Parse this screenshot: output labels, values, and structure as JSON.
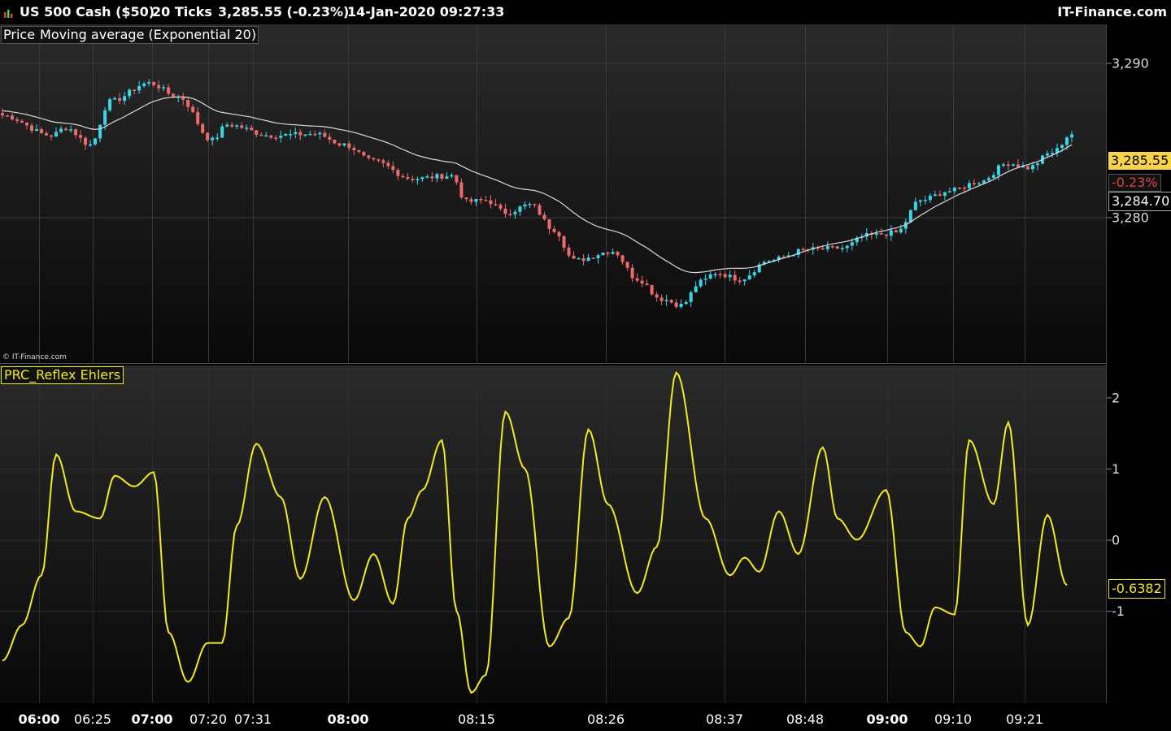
{
  "header": {
    "instrument": "US 500 Cash ($50)",
    "timeframe": "20 Ticks",
    "last_quote": "3,285.55 (-0.23%)",
    "datetime": "14-Jan-2020 09:27:33",
    "brand": "IT-Finance.com"
  },
  "price_panel": {
    "legend_price": "Price",
    "legend_ma": "Moving average (Exponential 20)",
    "copyright": "© IT-Finance.com",
    "last_price_label": "3,285.55",
    "change_label": "-0.23%",
    "ma_value_label": "3,284.70"
  },
  "indicator_panel": {
    "legend": "PRC_Reflex Ehlers",
    "last_value_label": "-0.6382"
  },
  "colors": {
    "background": "#000000",
    "up_bar": "#3ad6ec",
    "down_bar": "#f06a6a",
    "ma_line": "#d8d8d8",
    "indicator_line": "#f2ea1e",
    "price_tag_bg": "#f8d24a",
    "change_text": "#e04040"
  },
  "chart_data": [
    {
      "type": "candlestick",
      "title": "US 500 Cash ($50)",
      "ylim": [
        3270.6,
        3292.5
      ],
      "y_ticks": [
        3290,
        3280
      ],
      "y_tick_labels": [
        "3,290",
        "3,280"
      ],
      "x_tick_labels": [
        "06:00",
        "06:25",
        "07:00",
        "07:20",
        "07:31",
        "08:00",
        "08:15",
        "08:26",
        "08:37",
        "08:48",
        "09:00",
        "09:10",
        "09:21"
      ],
      "x_tick_bold": [
        true,
        false,
        true,
        false,
        false,
        true,
        false,
        false,
        false,
        false,
        true,
        false,
        false
      ],
      "bars": 220,
      "close_keypoints": [
        [
          0,
          3286.6
        ],
        [
          10,
          3285.3
        ],
        [
          13,
          3285.8
        ],
        [
          18,
          3284.7
        ],
        [
          22,
          3287.5
        ],
        [
          30,
          3288.7
        ],
        [
          36,
          3287.8
        ],
        [
          43,
          3285.0
        ],
        [
          46,
          3286.0
        ],
        [
          55,
          3285.3
        ],
        [
          64,
          3285.4
        ],
        [
          70,
          3284.7
        ],
        [
          76,
          3283.6
        ],
        [
          84,
          3282.5
        ],
        [
          92,
          3282.7
        ],
        [
          95,
          3281.0
        ],
        [
          99,
          3281.1
        ],
        [
          103,
          3280.3
        ],
        [
          108,
          3280.8
        ],
        [
          113,
          3279.2
        ],
        [
          117,
          3277.2
        ],
        [
          125,
          3277.8
        ],
        [
          130,
          3276.0
        ],
        [
          135,
          3274.7
        ],
        [
          139,
          3274.3
        ],
        [
          143,
          3275.8
        ],
        [
          146,
          3276.4
        ],
        [
          151,
          3276.0
        ],
        [
          157,
          3277.2
        ],
        [
          165,
          3277.9
        ],
        [
          172,
          3278.0
        ],
        [
          177,
          3278.8
        ],
        [
          183,
          3279.0
        ],
        [
          188,
          3281.1
        ],
        [
          194,
          3281.7
        ],
        [
          200,
          3282.3
        ],
        [
          206,
          3283.5
        ],
        [
          210,
          3283.2
        ],
        [
          215,
          3284.2
        ],
        [
          219,
          3285.4
        ]
      ],
      "series": [
        {
          "name": "Moving average (Exponential 20)",
          "last": 3284.7
        }
      ],
      "last_price": 3285.55,
      "change_percent": -0.23
    },
    {
      "type": "line",
      "title": "PRC_Reflex Ehlers",
      "ylim": [
        -2.3,
        2.45
      ],
      "y_ticks": [
        2,
        1,
        0,
        -1
      ],
      "y_tick_labels": [
        "2",
        "1",
        "0",
        "-1"
      ],
      "series": [
        {
          "name": "PRC_Reflex Ehlers",
          "keypoints": [
            [
              0,
              -1.7
            ],
            [
              4,
              -1.2
            ],
            [
              8,
              -0.5
            ],
            [
              11,
              1.2
            ],
            [
              15,
              0.4
            ],
            [
              20,
              0.3
            ],
            [
              23,
              0.9
            ],
            [
              27,
              0.75
            ],
            [
              31,
              0.95
            ],
            [
              34,
              -1.3
            ],
            [
              38,
              -2.0
            ],
            [
              42,
              -1.45
            ],
            [
              45,
              -1.45
            ],
            [
              48,
              0.2
            ],
            [
              52,
              1.35
            ],
            [
              57,
              0.6
            ],
            [
              61,
              -0.55
            ],
            [
              66,
              0.6
            ],
            [
              72,
              -0.85
            ],
            [
              76,
              -0.2
            ],
            [
              80,
              -0.9
            ],
            [
              83,
              0.3
            ],
            [
              86,
              0.7
            ],
            [
              90,
              1.4
            ],
            [
              93,
              -1.0
            ],
            [
              96,
              -2.15
            ],
            [
              99,
              -1.9
            ],
            [
              103,
              1.8
            ],
            [
              107,
              1.0
            ],
            [
              112,
              -1.5
            ],
            [
              116,
              -1.1
            ],
            [
              120,
              1.55
            ],
            [
              124,
              0.5
            ],
            [
              130,
              -0.75
            ],
            [
              134,
              -0.1
            ],
            [
              138,
              2.35
            ],
            [
              144,
              0.3
            ],
            [
              149,
              -0.5
            ],
            [
              152,
              -0.25
            ],
            [
              155,
              -0.45
            ],
            [
              159,
              0.4
            ],
            [
              163,
              -0.2
            ],
            [
              168,
              1.3
            ],
            [
              171,
              0.3
            ],
            [
              175,
              0.0
            ],
            [
              181,
              0.7
            ],
            [
              185,
              -1.3
            ],
            [
              188,
              -1.5
            ],
            [
              191,
              -0.95
            ],
            [
              195,
              -1.05
            ],
            [
              198,
              1.4
            ],
            [
              203,
              0.5
            ],
            [
              206,
              1.65
            ],
            [
              210,
              -1.2
            ],
            [
              214,
              0.35
            ],
            [
              218,
              -0.64
            ]
          ]
        }
      ],
      "last_value": -0.6382
    }
  ]
}
